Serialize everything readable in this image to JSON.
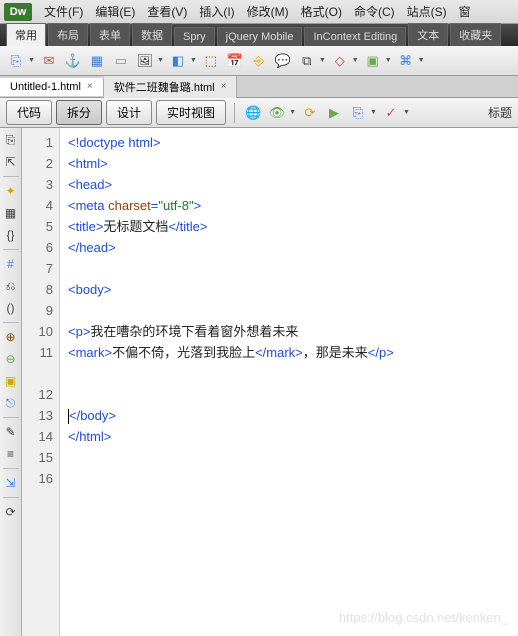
{
  "app": {
    "logo": "Dw"
  },
  "menu": [
    "文件(F)",
    "编辑(E)",
    "查看(V)",
    "插入(I)",
    "修改(M)",
    "格式(O)",
    "命令(C)",
    "站点(S)",
    "窗"
  ],
  "category_tabs": [
    {
      "label": "常用",
      "active": true
    },
    {
      "label": "布局",
      "active": false
    },
    {
      "label": "表单",
      "active": false
    },
    {
      "label": "数据",
      "active": false
    },
    {
      "label": "Spry",
      "active": false
    },
    {
      "label": "jQuery Mobile",
      "active": false
    },
    {
      "label": "InContext Editing",
      "active": false
    },
    {
      "label": "文本",
      "active": false
    },
    {
      "label": "收藏夹",
      "active": false
    }
  ],
  "doc_tabs": [
    {
      "label": "Untitled-1.html",
      "active": true
    },
    {
      "label": "软件二班魏鲁璐.html",
      "active": false
    }
  ],
  "view_buttons": {
    "code": "代码",
    "split": "拆分",
    "design": "设计",
    "live": "实时视图",
    "title_label": "标题"
  },
  "code_lines": [
    {
      "n": 1,
      "parts": [
        {
          "t": "tag",
          "v": "<!doctype html>"
        }
      ]
    },
    {
      "n": 2,
      "parts": [
        {
          "t": "tag",
          "v": "<html>"
        }
      ]
    },
    {
      "n": 3,
      "parts": [
        {
          "t": "tag",
          "v": "<head>"
        }
      ]
    },
    {
      "n": 4,
      "parts": [
        {
          "t": "tag",
          "v": "<meta "
        },
        {
          "t": "attr-name",
          "v": "charset"
        },
        {
          "t": "tag",
          "v": "="
        },
        {
          "t": "attr-val",
          "v": "\"utf-8\""
        },
        {
          "t": "tag",
          "v": ">"
        }
      ]
    },
    {
      "n": 5,
      "parts": [
        {
          "t": "tag",
          "v": "<title>"
        },
        {
          "t": "txt",
          "v": "无标题文档"
        },
        {
          "t": "tag",
          "v": "</title>"
        }
      ]
    },
    {
      "n": 6,
      "parts": [
        {
          "t": "tag",
          "v": "</head>"
        }
      ]
    },
    {
      "n": 7,
      "parts": []
    },
    {
      "n": 8,
      "parts": [
        {
          "t": "tag",
          "v": "<body>"
        }
      ]
    },
    {
      "n": 9,
      "parts": []
    },
    {
      "n": 10,
      "parts": [
        {
          "t": "tag",
          "v": "<p>"
        },
        {
          "t": "txt",
          "v": "我在嘈杂的环境下看着窗外想着未来"
        }
      ]
    },
    {
      "n": 11,
      "parts": [
        {
          "t": "tag",
          "v": "<mark>"
        },
        {
          "t": "txt",
          "v": "不偏不倚，光落到我脸上"
        },
        {
          "t": "tag",
          "v": "</mark>"
        },
        {
          "t": "txt",
          "v": "，那是未来"
        },
        {
          "t": "tag",
          "v": "</p>"
        }
      ],
      "wrap": true
    },
    {
      "n": 12,
      "parts": []
    },
    {
      "n": 13,
      "parts": []
    },
    {
      "n": 14,
      "parts": [
        {
          "t": "cursor",
          "v": ""
        },
        {
          "t": "tag",
          "v": "</body>"
        }
      ]
    },
    {
      "n": 15,
      "parts": [
        {
          "t": "tag",
          "v": "</html>"
        }
      ]
    },
    {
      "n": 16,
      "parts": []
    }
  ],
  "watermark": "https://blog.csdn.net/kenken_"
}
